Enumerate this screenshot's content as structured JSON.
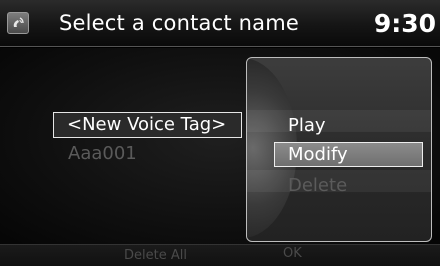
{
  "header": {
    "title": "Select a contact name",
    "clock": "9:30",
    "icon": "voice-command-icon"
  },
  "list": {
    "items": [
      {
        "label": "<New Voice Tag>",
        "state": "selected"
      },
      {
        "label": "Aaa001",
        "state": "dimmed"
      }
    ]
  },
  "bottom_bar": {
    "delete_all": "Delete All",
    "ok": "OK"
  },
  "popup_menu": {
    "items": [
      {
        "label": "Play",
        "state": "normal"
      },
      {
        "label": "Modify",
        "state": "highlighted"
      },
      {
        "label": "Delete",
        "state": "disabled"
      }
    ]
  },
  "colors": {
    "background": "#000000",
    "text": "#ffffff",
    "disabled_text": "#5a5a5a",
    "highlight": "#7d7d7d"
  }
}
